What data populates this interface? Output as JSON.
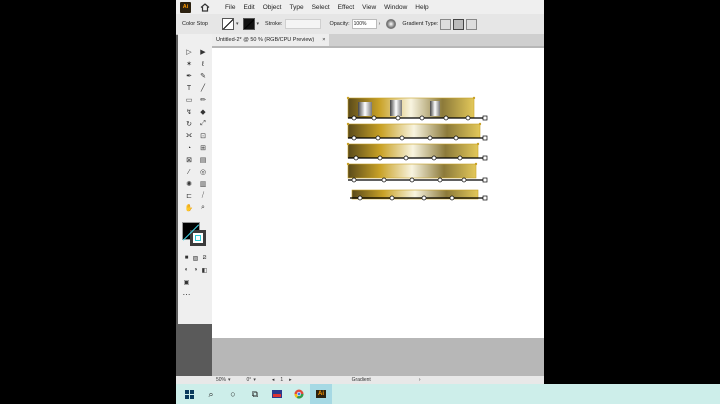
{
  "menubar": {
    "app_badge": "Ai",
    "items": [
      "File",
      "Edit",
      "Object",
      "Type",
      "Select",
      "Effect",
      "View",
      "Window",
      "Help"
    ]
  },
  "controlbar": {
    "selection_label": "Color Stop",
    "stroke_label": "Stroke:",
    "opacity_label": "Opacity:",
    "opacity_value": "100%",
    "gradient_type_label": "Gradient Type:"
  },
  "document": {
    "tab_title": "Untitled-2* @ 50 % (RGB/CPU Preview)",
    "tab_close": "×"
  },
  "statusbar": {
    "zoom": "50%",
    "rotation": "0°",
    "artboard_num": "1",
    "mode": "Gradient"
  },
  "taskbar": {
    "illustrator_label": "Ai"
  },
  "colors": {
    "taskbar_bg": "#cdeeea",
    "artwork_gold": "#c9a227",
    "ai_orange": "#ff9a00"
  }
}
